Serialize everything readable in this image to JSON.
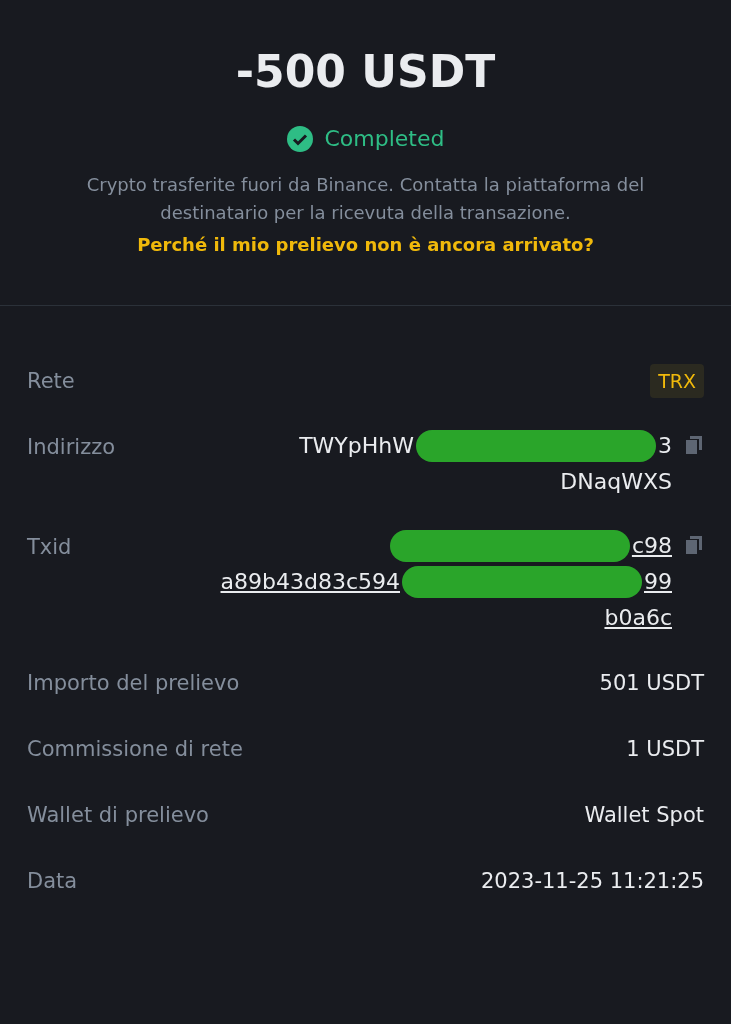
{
  "amount": "-500 USDT",
  "status": {
    "kind": "completed",
    "label": "Completed"
  },
  "description": "Crypto trasferite fuori da Binance. Contatta la piattaforma del destinatario per la ricevuta della transazione.",
  "help_link": "Perché il mio prelievo non è ancora arrivato?",
  "details": [
    {
      "kind": "badge",
      "label": "Rete",
      "value": "TRX"
    },
    {
      "kind": "address",
      "label": "Indirizzo",
      "link": false,
      "lines": [
        [
          {
            "kind": "text",
            "text": "TWYpHhW"
          },
          {
            "kind": "redaction"
          },
          {
            "kind": "text",
            "text": "3"
          }
        ],
        [
          {
            "kind": "text",
            "text": "DNaqWXS"
          }
        ]
      ]
    },
    {
      "kind": "address",
      "label": "Txid",
      "link": true,
      "lines": [
        [
          {
            "kind": "redaction"
          },
          {
            "kind": "text",
            "text": "c98"
          }
        ],
        [
          {
            "kind": "text",
            "text": "a89b43d83c594"
          },
          {
            "kind": "redaction"
          },
          {
            "kind": "text",
            "text": "99"
          }
        ],
        [
          {
            "kind": "text",
            "text": "b0a6c"
          }
        ]
      ]
    },
    {
      "kind": "text",
      "label": "Importo del prelievo",
      "value": "501 USDT"
    },
    {
      "kind": "text",
      "label": "Commissione di rete",
      "value": "1 USDT"
    },
    {
      "kind": "text",
      "label": "Wallet di prelievo",
      "value": "Wallet Spot"
    },
    {
      "kind": "text",
      "label": "Data",
      "value": "2023-11-25 11:21:25"
    }
  ]
}
